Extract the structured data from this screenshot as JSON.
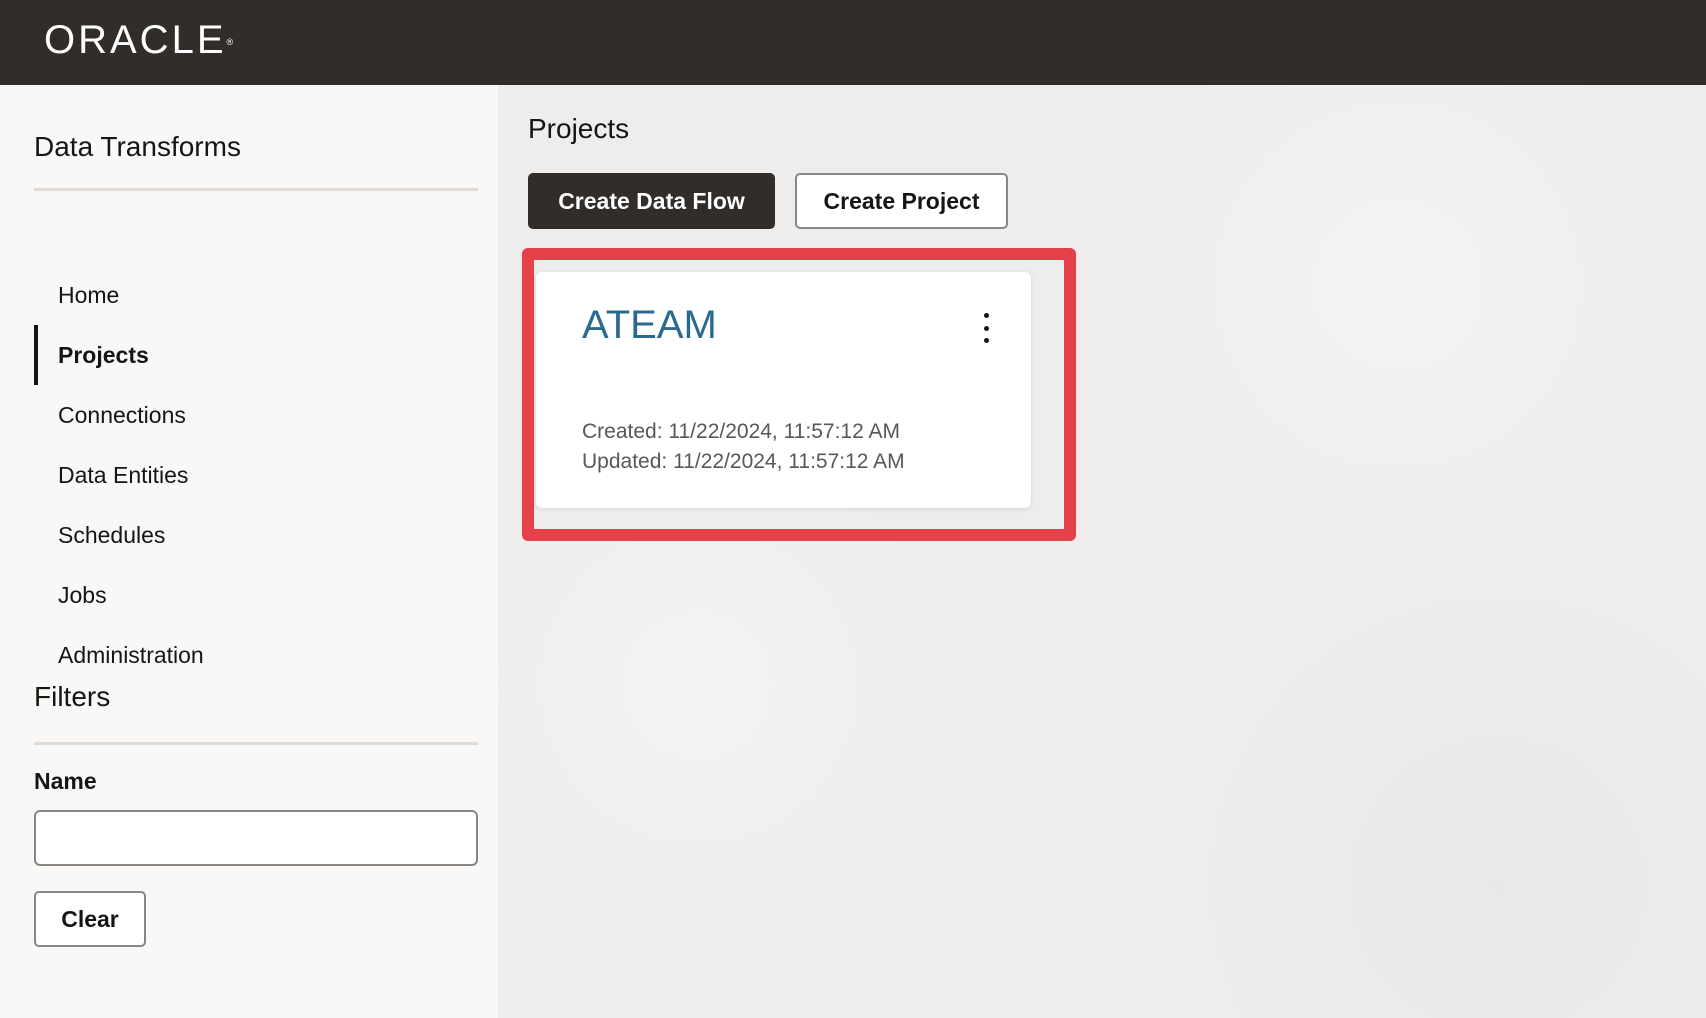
{
  "header": {
    "logo_text": "ORACLE",
    "logo_mark": "®"
  },
  "sidebar": {
    "title": "Data Transforms",
    "items": [
      {
        "label": "Home",
        "active": false
      },
      {
        "label": "Projects",
        "active": true
      },
      {
        "label": "Connections",
        "active": false
      },
      {
        "label": "Data Entities",
        "active": false
      },
      {
        "label": "Schedules",
        "active": false
      },
      {
        "label": "Jobs",
        "active": false
      },
      {
        "label": "Administration",
        "active": false
      }
    ],
    "filters": {
      "title": "Filters",
      "name_label": "Name",
      "name_value": "",
      "clear_label": "Clear"
    }
  },
  "main": {
    "page_title": "Projects",
    "create_data_flow_label": "Create Data Flow",
    "create_project_label": "Create Project",
    "project_card": {
      "name": "ATEAM",
      "created": "Created: 11/22/2024, 11:57:12 AM",
      "updated": "Updated: 11/22/2024, 11:57:12 AM",
      "menu_icon": "kebab-menu-icon"
    }
  },
  "colors": {
    "header_bg": "#312d2a",
    "highlight": "#e5414b",
    "project_link": "#2b6a8f"
  }
}
